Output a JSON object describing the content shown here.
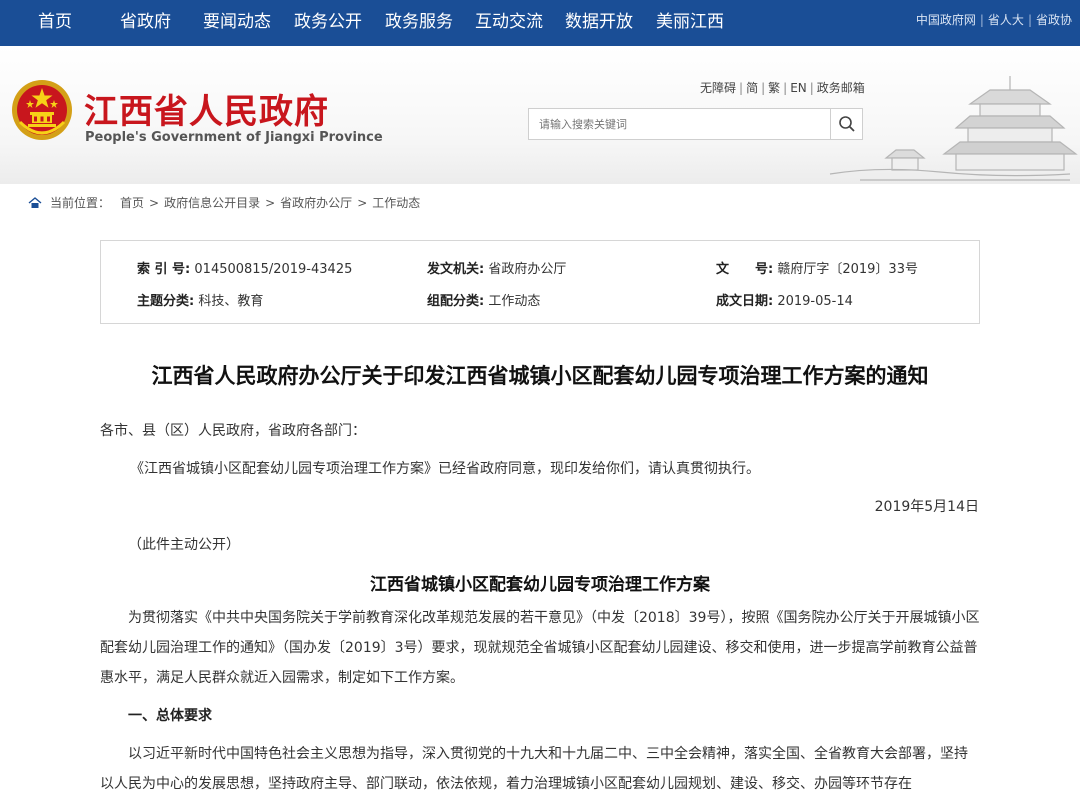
{
  "nav": {
    "items": [
      "首页",
      "省政府",
      "要闻动态",
      "政务公开",
      "政务服务",
      "互动交流",
      "数据开放",
      "美丽江西"
    ],
    "links": [
      "中国政府网",
      "省人大",
      "省政协"
    ]
  },
  "header": {
    "title": "江西省人民政府",
    "subtitle": "People's Government of Jiangxi Province",
    "tools": [
      "无障碍",
      "简",
      "繁",
      "EN",
      "政务邮箱"
    ],
    "search_placeholder": "请输入搜索关键词"
  },
  "breadcrumb": {
    "label": "当前位置：",
    "items": [
      "首页",
      "政府信息公开目录",
      "省政府办公厅",
      "工作动态"
    ]
  },
  "meta": {
    "index_label": "索 引 号:",
    "index_value": "014500815/2019-43425",
    "issuer_label": "发文机关:",
    "issuer_value": "省政府办公厅",
    "docno_label": "文　　号:",
    "docno_value": "赣府厅字〔2019〕33号",
    "topic_label": "主题分类:",
    "topic_value": "科技、教育",
    "group_label": "组配分类:",
    "group_value": "工作动态",
    "date_label": "成文日期:",
    "date_value": "2019-05-14"
  },
  "document": {
    "title": "江西省人民政府办公厅关于印发江西省城镇小区配套幼儿园专项治理工作方案的通知",
    "salutation": "各市、县（区）人民政府，省政府各部门：",
    "body": "《江西省城镇小区配套幼儿园专项治理工作方案》已经省政府同意，现印发给你们，请认真贯彻执行。",
    "date": "2019年5月14日",
    "disclosure": "（此件主动公开）",
    "plan_title": "江西省城镇小区配套幼儿园专项治理工作方案",
    "plan_para1": "为贯彻落实《中共中央国务院关于学前教育深化改革规范发展的若干意见》（中发〔2018〕39号），按照《国务院办公厅关于开展城镇小区配套幼儿园治理工作的通知》（国办发〔2019〕3号）要求，现就规范全省城镇小区配套幼儿园建设、移交和使用，进一步提高学前教育公益普惠水平，满足人民群众就近入园需求，制定如下工作方案。",
    "section1": "一、总体要求",
    "plan_para2": "以习近平新时代中国特色社会主义思想为指导，深入贯彻党的十九大和十九届二中、三中全会精神，落实全国、全省教育大会部署，坚持以人民为中心的发展思想，坚持政府主导、部门联动，依法依规，着力治理城镇小区配套幼儿园规划、建设、移交、办园等环节存在"
  },
  "colors": {
    "nav_bg": "#1a4e96",
    "title_red": "#c8161d"
  }
}
